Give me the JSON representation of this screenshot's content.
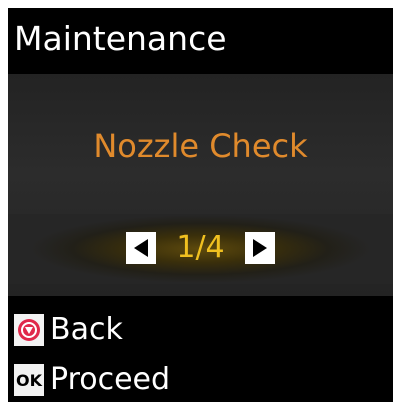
{
  "header": {
    "title": "Maintenance"
  },
  "menu": {
    "item_label": "Nozzle Check",
    "page_indicator": "1/4",
    "prev_icon": "left-triangle-icon",
    "next_icon": "right-triangle-icon"
  },
  "footer": {
    "back": {
      "icon": "stop-icon",
      "label": "Back"
    },
    "proceed": {
      "icon_text": "OK",
      "label": "Proceed"
    }
  },
  "colors": {
    "background": "#000000",
    "panel": "#2a2a2a",
    "title_text": "#e08a2c",
    "page_indicator": "#f0c020",
    "text": "#ffffff",
    "stop_red": "#e0284a"
  }
}
